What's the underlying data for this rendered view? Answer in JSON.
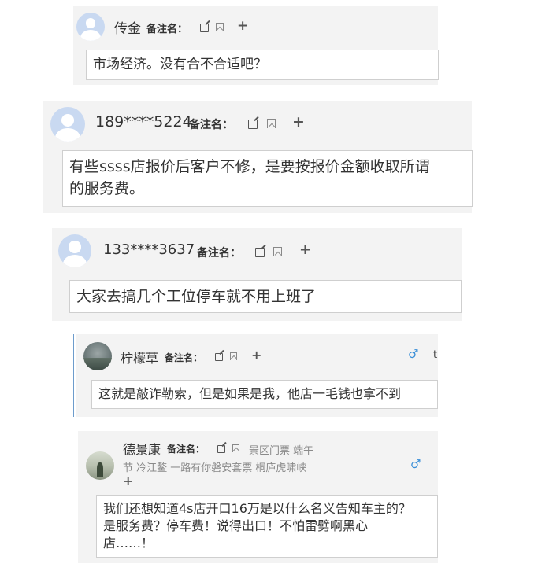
{
  "comments": [
    {
      "user": "传金",
      "remark_label": "备注名：",
      "text": "市场经济。没有合不合适吧？"
    },
    {
      "user": "189****5224",
      "remark_label": "备注名：",
      "text_line1": "有些ssss店报价后客户不修，是要按报价金额收取所谓",
      "text_line2": "的服务费。"
    },
    {
      "user": "133****3637",
      "remark_label": "备注名：",
      "text": "大家去搞几个工位停车就不用上班了"
    },
    {
      "user": "柠檬草",
      "remark_label": "备注名：",
      "text": "这就是敲诈勒索，但是如果是我，他店一毛钱也拿不到",
      "gender": "♂",
      "extra": "t"
    },
    {
      "user": "德景康",
      "remark_label": "备注名：",
      "tags_line1": "景区门票  端午",
      "tags_line2": "节  冷江鳌  一路有你磐安套票  桐庐虎啸峡",
      "text_line1": "我们还想知道4s店开口16万是以什么名义告知车主的？",
      "text_line2": "是服务费？停车费！说得出口！不怕雷劈啊黑心",
      "text_line3": "店……！",
      "gender": "♂"
    }
  ],
  "icons": {
    "edit": "edit-icon",
    "bookmark": "bookmark-icon",
    "add": "plus-icon",
    "gender": "male-icon"
  },
  "colors": {
    "card_bg": "#f3f3f3",
    "thread_line": "#6d9ccc",
    "gender": "#3a8fd8"
  }
}
